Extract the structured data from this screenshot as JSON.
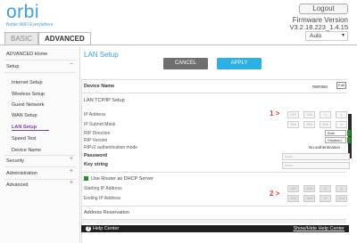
{
  "header": {
    "logo_word": "orbi",
    "logo_tagline": "Better WiFi Everywhere",
    "logout_label": "Logout",
    "firmware_label": "Firmware Version",
    "firmware_value": "V3.2.18.223_1.4.15",
    "language_value": "Auto",
    "tabs": [
      {
        "label": "BASIC",
        "active": false
      },
      {
        "label": "ADVANCED",
        "active": true
      }
    ]
  },
  "sidebar": {
    "items": [
      {
        "label": "ADVANCED Home",
        "level": "top"
      },
      {
        "label": "Setup",
        "level": "top",
        "toggle": "−"
      },
      {
        "label": "Internet Setup",
        "level": "sub"
      },
      {
        "label": "Wireless Setup",
        "level": "sub"
      },
      {
        "label": "Guest Network",
        "level": "sub"
      },
      {
        "label": "WAN Setup",
        "level": "sub"
      },
      {
        "label": "LAN Setup",
        "level": "sub",
        "active": true
      },
      {
        "label": "Speed Test",
        "level": "sub"
      },
      {
        "label": "Device Name",
        "level": "sub"
      },
      {
        "label": "Security",
        "level": "top",
        "toggle": "+"
      },
      {
        "label": "Administration",
        "level": "top",
        "toggle": "+"
      },
      {
        "label": "Advanced",
        "level": "top",
        "toggle": "+"
      }
    ]
  },
  "main": {
    "title": "LAN Setup",
    "cancel_label": "CANCEL",
    "apply_label": "APPLY",
    "device_name_label": "Device Name",
    "device_name_value": "RBR850",
    "edit_label": "Edit",
    "lan_tcpip_title": "LAN TCP/IP Setup",
    "ip_address_label": "IP Address",
    "ip_address": [
      "192",
      "168",
      "0",
      "1"
    ],
    "subnet_label": "IP Subnet Mask",
    "subnet": [
      "255",
      "255",
      "255",
      "0"
    ],
    "rip_direction_label": "RIP Direction",
    "rip_direction_value": "Both",
    "rip_version_label": "RIP Version",
    "rip_version_value": "Disabled",
    "ripv2_label": "RIPv2 authentication mode",
    "ripv2_value": "No authentication",
    "password_label": "Password",
    "password_placeholder": "basic",
    "key_string_label": "Key string",
    "key_string_placeholder": "basic",
    "dhcp_label": "Use Router as DHCP Server",
    "starting_ip_label": "Starting IP Address",
    "starting_ip": [
      "192",
      "168",
      "0",
      "2"
    ],
    "ending_ip_label": "Ending IP Address",
    "ending_ip": [
      "192",
      "168",
      "0",
      "254"
    ],
    "address_reservation_title": "Address Reservation",
    "marker_1": "1 >",
    "marker_2": "2 >"
  },
  "footer": {
    "help_label": "Help Center",
    "show_hide_label": "Show/Hide Help Center"
  },
  "colors": {
    "brand": "#3fa0d8",
    "apply": "#2bb0e4",
    "cancel": "#6f6f6f",
    "active_nav": "#7b3fa0",
    "marker": "#e53935",
    "toggle_green": "#2e8b2e"
  }
}
